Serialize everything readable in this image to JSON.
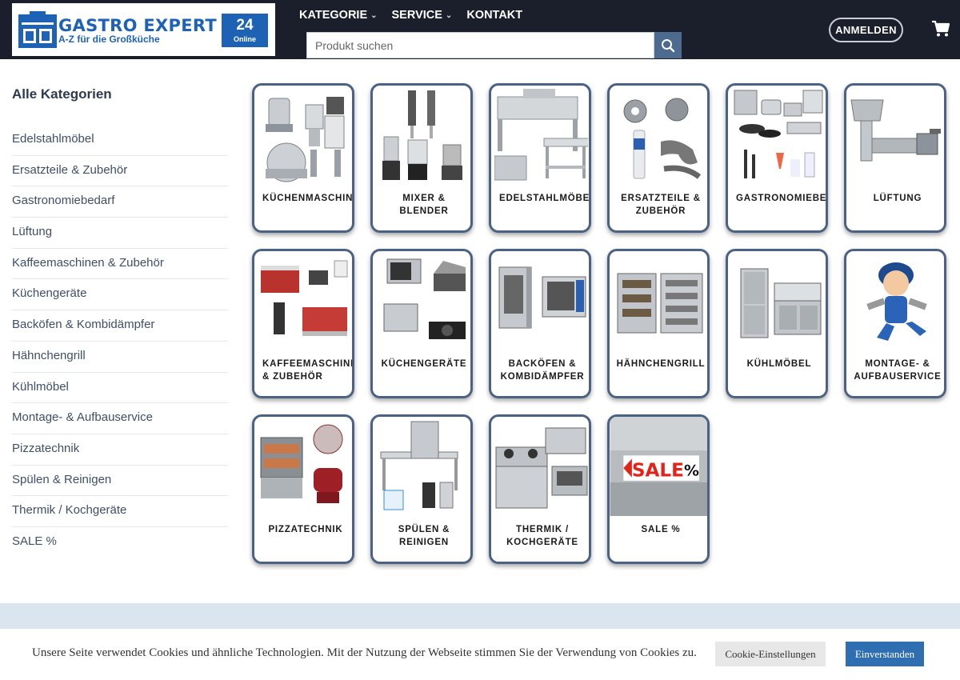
{
  "logo": {
    "word": "GASTRO EXPERT",
    "tagline": "A-Z für die Großküche",
    "badge_number": "24",
    "badge_text": "Online"
  },
  "nav": {
    "items": [
      {
        "label": "KATEGORIE",
        "icon": "chevron-down-icon"
      },
      {
        "label": "SERVICE",
        "icon": "chevron-down-icon"
      },
      {
        "label": "KONTAKT"
      }
    ]
  },
  "search": {
    "placeholder": "Produkt suchen",
    "icon": "search-icon"
  },
  "header": {
    "login_label": "ANMELDEN",
    "cart_icon": "cart-icon"
  },
  "sidebar": {
    "title": "Alle Kategorien",
    "items": [
      "Edelstahlmöbel",
      "Ersatzteile & Zubehör",
      "Gastronomiebedarf",
      "Lüftung",
      "Kaffeemaschinen & Zubehör",
      "Küchengeräte",
      "Backöfen & Kombidämpfer",
      "Hähnchengrill",
      "Kühlmöbel",
      "Montage- & Aufbauservice",
      "Pizzatechnik",
      "Spülen & Reinigen",
      "Thermik / Kochgeräte",
      "SALE %"
    ]
  },
  "categories": [
    {
      "line1": "KÜCHENMASCHINEN",
      "line2": ""
    },
    {
      "line1": "MIXER &",
      "line2": "BLENDER"
    },
    {
      "line1": "EDELSTAHLMÖBEL",
      "line2": ""
    },
    {
      "line1": "ERSATZTEILE &",
      "line2": "ZUBEHÖR"
    },
    {
      "line1": "GASTRONOMIEBEDARF",
      "line2": ""
    },
    {
      "line1": "LÜFTUNG",
      "line2": ""
    },
    {
      "line1": "KAFFEEMASCHINEN",
      "line2": "& ZUBEHÖR"
    },
    {
      "line1": "KÜCHENGERÄTE",
      "line2": ""
    },
    {
      "line1": "BACKÖFEN &",
      "line2": "KOMBIDÄMPFER"
    },
    {
      "line1": "HÄHNCHENGRILL",
      "line2": ""
    },
    {
      "line1": "KÜHLMÖBEL",
      "line2": ""
    },
    {
      "line1": "MONTAGE- &",
      "line2": "AUFBAUSERVICE"
    },
    {
      "line1": "PIZZATECHNIK",
      "line2": ""
    },
    {
      "line1": "SPÜLEN &",
      "line2": "REINIGEN"
    },
    {
      "line1": "THERMIK /",
      "line2": "KOCHGERÄTE"
    },
    {
      "line1": "SALE %",
      "line2": ""
    }
  ],
  "sale_image_text": "SALE",
  "cookie": {
    "text": "Unsere Seite verwendet Cookies und ähnliche Technologien. Mit der Nutzung der Webseite stimmen Sie der Verwendung von Cookies zu.",
    "settings_label": "Cookie-Einstellungen",
    "accept_label": "Einverstanden"
  },
  "colors": {
    "header_bg": "#1b1e2b",
    "brand_blue": "#1e62b5",
    "card_border": "#4b6283",
    "search_button": "#4d6a8f",
    "accept_button": "#2f6fb1"
  }
}
